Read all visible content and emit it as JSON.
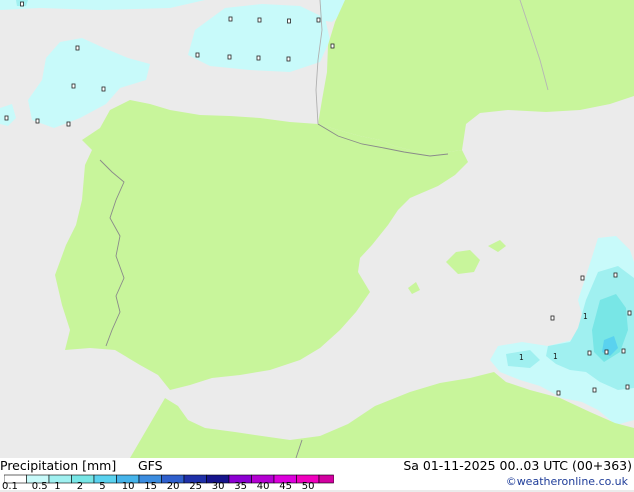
{
  "footer": {
    "title": "Precipitation [mm]",
    "model": "GFS",
    "valid": "Sa 01-11-2025 00..03 UTC (00+363)",
    "credit": "©weatheronline.co.uk"
  },
  "legend": {
    "ticks": [
      "0.1",
      "0.5",
      "1",
      "2",
      "5",
      "10",
      "15",
      "20",
      "25",
      "30",
      "35",
      "40",
      "45",
      "50"
    ],
    "colors": [
      "#ffffff",
      "#c8fafa",
      "#a0f0f0",
      "#78e6e6",
      "#5ad2ef",
      "#46b4ea",
      "#3c8cdf",
      "#2f5fcc",
      "#1f30a8",
      "#16148c",
      "#8c00d2",
      "#b400d2",
      "#dc00dc",
      "#f000be",
      "#d200a0"
    ]
  },
  "map": {
    "colors": {
      "sea": "#ebebeb",
      "land": "#c8f59b",
      "border": "#8a8a8a",
      "rain_light": "#c8fafa",
      "rain_mid": "#a0f0f0",
      "rain_high": "#78e6e6",
      "rain_peak": "#5ad2ef"
    },
    "contour_labels": [
      "1",
      "1",
      "1"
    ]
  }
}
